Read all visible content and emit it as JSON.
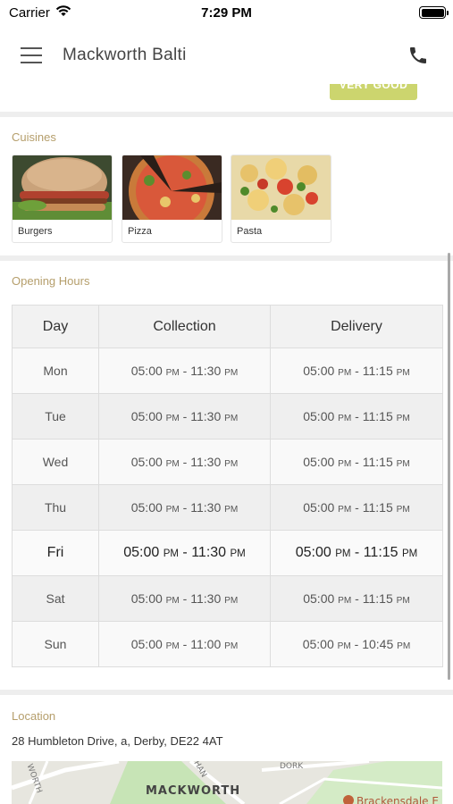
{
  "status_bar": {
    "carrier": "Carrier",
    "time": "7:29 PM"
  },
  "header": {
    "title": "Mackworth Balti"
  },
  "rating": {
    "label": "VERY GOOD",
    "color": "#ccd56e"
  },
  "cuisines": {
    "heading": "Cuisines",
    "items": [
      {
        "label": "Burgers",
        "icon": "burger-photo"
      },
      {
        "label": "Pizza",
        "icon": "pizza-photo"
      },
      {
        "label": "Pasta",
        "icon": "pasta-photo"
      }
    ]
  },
  "opening_hours": {
    "heading": "Opening Hours",
    "columns": [
      "Day",
      "Collection",
      "Delivery"
    ],
    "rows": [
      {
        "day": "Mon",
        "collection": "05:00 PM - 11:30 PM",
        "delivery": "05:00 PM - 11:15 PM"
      },
      {
        "day": "Tue",
        "collection": "05:00 PM - 11:30 PM",
        "delivery": "05:00 PM - 11:15 PM"
      },
      {
        "day": "Wed",
        "collection": "05:00 PM - 11:30 PM",
        "delivery": "05:00 PM - 11:15 PM"
      },
      {
        "day": "Thu",
        "collection": "05:00 PM - 11:30 PM",
        "delivery": "05:00 PM - 11:15 PM"
      },
      {
        "day": "Fri",
        "collection": "05:00 PM - 11:30 PM",
        "delivery": "05:00 PM - 11:15 PM",
        "current": true
      },
      {
        "day": "Sat",
        "collection": "05:00 PM - 11:30 PM",
        "delivery": "05:00 PM - 11:15 PM"
      },
      {
        "day": "Sun",
        "collection": "05:00 PM - 11:00 PM",
        "delivery": "05:00 PM - 10:45 PM"
      }
    ]
  },
  "location": {
    "heading": "Location",
    "address": "28 Humbleton Drive, a, Derby, DE22 4AT",
    "map_labels": {
      "area": "MACKWORTH",
      "place": "Brackensdale E",
      "road1": "HAN",
      "road2": "DORK",
      "road3": "WORTH"
    }
  },
  "colors": {
    "accent": "#b59e6b",
    "rating": "#ccd56e",
    "map_pin": "#c0623a"
  }
}
